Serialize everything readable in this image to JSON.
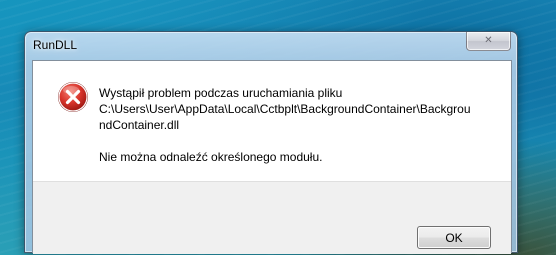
{
  "window": {
    "title": "RunDLL"
  },
  "dialog": {
    "icon": "error-icon",
    "message_lines": [
      "Wystąpił problem podczas uruchamiania pliku",
      "C:\\Users\\User\\AppData\\Local\\Cctbplt\\BackgroundContainer\\Backgrou",
      "ndContainer.dll"
    ],
    "detail": "Nie można odnaleźć określonego modułu.",
    "ok_label": "OK"
  },
  "colors": {
    "error_red": "#d8342b",
    "dialog_bg": "#ffffff",
    "footer_bg": "#f0f0f0"
  }
}
